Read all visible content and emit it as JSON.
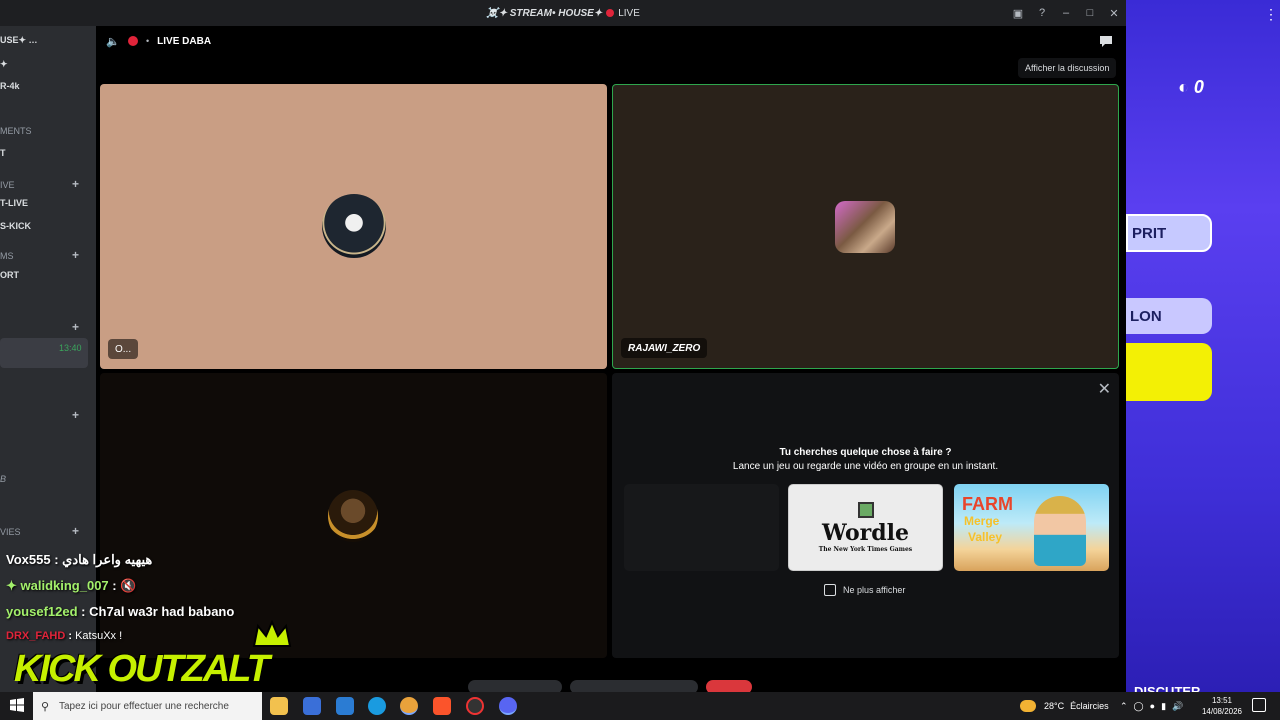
{
  "background_app": {
    "counter": "0",
    "pill1": "PRIT",
    "pill2": "LON",
    "bottom_label": "DISCUTER"
  },
  "window": {
    "title": "☠️✦ STREAM• HOUSE✦",
    "live_label": "LIVE"
  },
  "sidebar": {
    "items": [
      {
        "label": "USE✦ …"
      },
      {
        "label": "✦"
      },
      {
        "label": "R-4k"
      },
      {
        "label": "MENTS"
      },
      {
        "label": "T"
      },
      {
        "label": "IVE"
      },
      {
        "label": "T-LIVE"
      },
      {
        "label": "S-KICK"
      },
      {
        "label": "MS"
      },
      {
        "label": "ORT"
      },
      {
        "label": "13:40"
      },
      {
        "label": "B"
      },
      {
        "label": "VIES"
      }
    ]
  },
  "call": {
    "channel_name": "LIVE DABA",
    "tooltip": "Afficher la discussion"
  },
  "tiles": [
    {
      "label": "O..."
    },
    {
      "label": "RAJAWI_ZERO"
    },
    {
      "label": ""
    }
  ],
  "activity": {
    "question": "Tu cherches quelque chose à faire ?",
    "subtext": "Lance un jeu ou regarde une vidéo en groupe en un instant.",
    "cards": [
      {
        "title": "",
        "subtitle": ""
      },
      {
        "title": "Wordle",
        "subtitle": "The New York Times Games"
      },
      {
        "title": "Farm Merge Valley",
        "line1": "FARM",
        "line2": "Merge",
        "line3": "Valley"
      }
    ],
    "no_show_label": "Ne plus afficher"
  },
  "chat": {
    "messages": [
      {
        "user": "Vox555",
        "text": "هيهيه واعرا هادي"
      },
      {
        "user": "walidking_007",
        "text": ""
      },
      {
        "user": "yousef12ed",
        "text": "Ch7al wa3r had babano"
      },
      {
        "user": "DRX_FAHD",
        "text": "KatsuXx !"
      }
    ],
    "logo_text": "KICK OUTZALT"
  },
  "taskbar": {
    "search_placeholder": "Tapez ici pour effectuer une recherche",
    "weather_temp": "28°C",
    "weather_desc": "Éclaircies",
    "time": "13:51",
    "date": "14/08/2026"
  },
  "colors": {
    "accent_green": "#2ea64d",
    "live_red": "#e0243a",
    "sidebar_bg": "#2b2d31",
    "kick_green": "#c6f000"
  }
}
